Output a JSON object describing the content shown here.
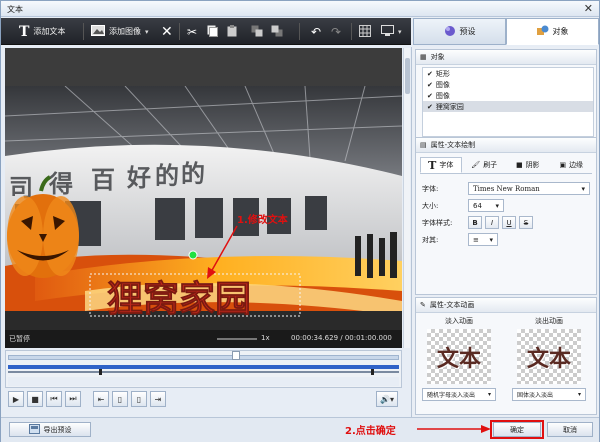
{
  "window": {
    "title": "文本"
  },
  "toolbar": {
    "add_text_label": "添加文本",
    "add_image_label": "添加图像"
  },
  "tabs": [
    {
      "label": "预设"
    },
    {
      "label": "对象"
    }
  ],
  "video": {
    "overlay_text": "狸窝家园",
    "status": "已暂停",
    "speed": "1x",
    "time": "00:00:34.629 / 00:01:00.000"
  },
  "annotations": {
    "step1": "1.修改文本",
    "step2": "2.点击确定"
  },
  "objects_panel": {
    "title": "对象",
    "items": [
      {
        "label": "矩形",
        "checked": true,
        "selected": false
      },
      {
        "label": "图像",
        "checked": true,
        "selected": false
      },
      {
        "label": "图像",
        "checked": true,
        "selected": false
      },
      {
        "label": "狸窝家园",
        "checked": true,
        "selected": true
      }
    ]
  },
  "text_props": {
    "title": "属性-文本绘制",
    "subtabs": [
      {
        "label": "字体"
      },
      {
        "label": "刷子"
      },
      {
        "label": "阴影"
      },
      {
        "label": "边缘"
      }
    ],
    "font_label": "字体:",
    "font_value": "Times New Roman",
    "size_label": "大小:",
    "size_value": "64",
    "style_label": "字体样式:",
    "style_buttons": [
      "B",
      "I",
      "U",
      "S"
    ],
    "align_label": "对其:",
    "align_value": "≡"
  },
  "anim_props": {
    "title": "属性-文本动画",
    "fade_in_label": "淡入动画",
    "fade_out_label": "淡出动画",
    "thumb_text": "文本",
    "fade_in_value": "随机字母淡入淡出",
    "fade_out_value": "固体淡入淡出"
  },
  "bottom": {
    "export_label": "导出预设",
    "ok_label": "确定",
    "cancel_label": "取消"
  },
  "colors": {
    "annotation": "#e01010",
    "overlay_text": "#c0281c",
    "toolbar_bg": "#2b2d33"
  }
}
